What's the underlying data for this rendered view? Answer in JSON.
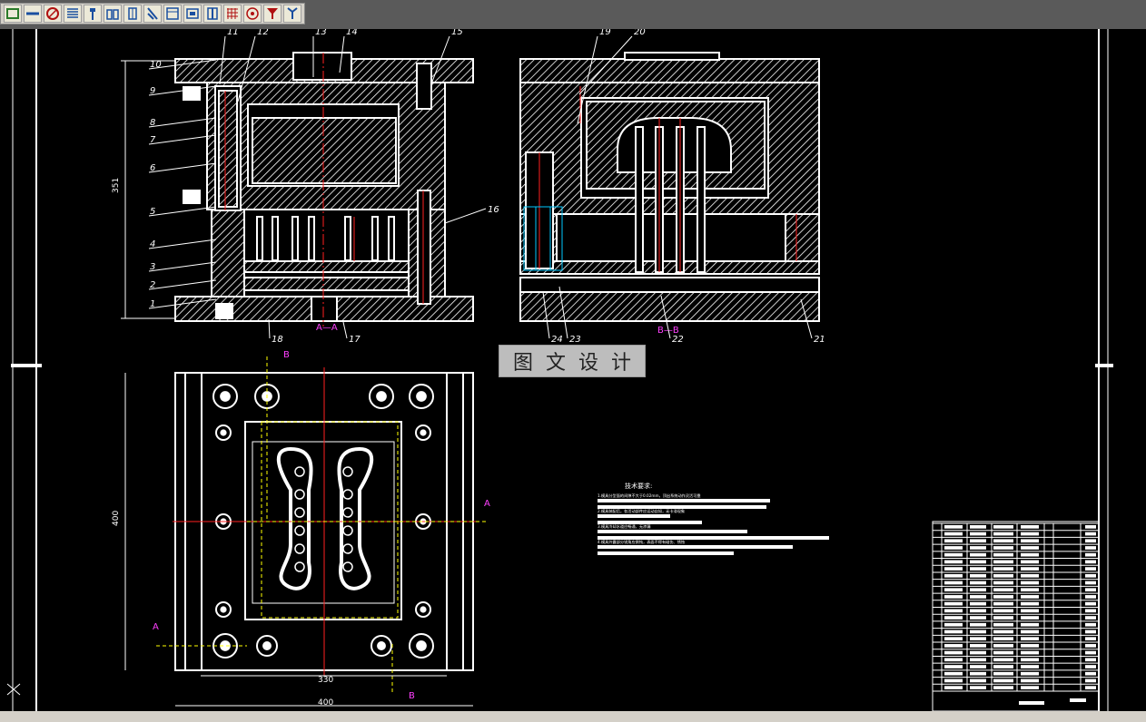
{
  "toolbar": {
    "buttons": [
      {
        "icon": "layer-icon",
        "color": "#2a7a2a"
      },
      {
        "icon": "hline-icon",
        "color": "#1a4fa0"
      },
      {
        "icon": "hatch-icon",
        "color": "#b01010"
      },
      {
        "icon": "stack-icon",
        "color": "#1a4fa0"
      },
      {
        "icon": "bolt-icon",
        "color": "#1a4fa0"
      },
      {
        "icon": "plate-icon",
        "color": "#1a4fa0"
      },
      {
        "icon": "pin-icon",
        "color": "#1a4fa0"
      },
      {
        "icon": "slant-icon",
        "color": "#1a4fa0"
      },
      {
        "icon": "frame-icon",
        "color": "#1a4fa0"
      },
      {
        "icon": "mold-icon",
        "color": "#1a4fa0"
      },
      {
        "icon": "insert-icon",
        "color": "#1a4fa0"
      },
      {
        "icon": "grid-icon",
        "color": "#b01010"
      },
      {
        "icon": "target-icon",
        "color": "#b01010"
      },
      {
        "icon": "funnel-icon",
        "color": "#b01010"
      },
      {
        "icon": "fork-icon",
        "color": "#1a4fa0"
      }
    ]
  },
  "drawing": {
    "balloons_left": [
      "10",
      "9",
      "8",
      "7",
      "6",
      "5",
      "4",
      "3",
      "2",
      "1"
    ],
    "balloons_top": [
      "11",
      "12",
      "13",
      "14",
      "15"
    ],
    "balloons_right_view": [
      "16",
      "17",
      "18"
    ],
    "balloons_top_right": [
      "20",
      "19"
    ],
    "balloons_bottom_right": [
      "24",
      "23",
      "22",
      "21"
    ],
    "section_labels": {
      "aa": "A—A",
      "bb": "B—B",
      "a": "A",
      "b": "B"
    },
    "dims": {
      "height": "351",
      "width_330": "330",
      "width_400": "400",
      "plan_height": "400"
    },
    "tech_title": "技术要求:",
    "tech_lines": [
      "1.模具分型面的间隙不大于0.02mm，顶出系统动作灵活可靠",
      "2.模具装配后，各活动部件应运动自如，无卡滞现象",
      "3.模具冷却水道应畅通，无渗漏",
      "4.模具外露部分锐角应倒钝，表面不得有碰伤、锈蚀"
    ],
    "title_block_rows": 24
  },
  "watermark": "图文设计",
  "colors": {
    "line": "#ffffff",
    "center": "#ff2020",
    "hidden": "#ffff00",
    "label": "#ff40ff",
    "cyan": "#00c8ff"
  }
}
